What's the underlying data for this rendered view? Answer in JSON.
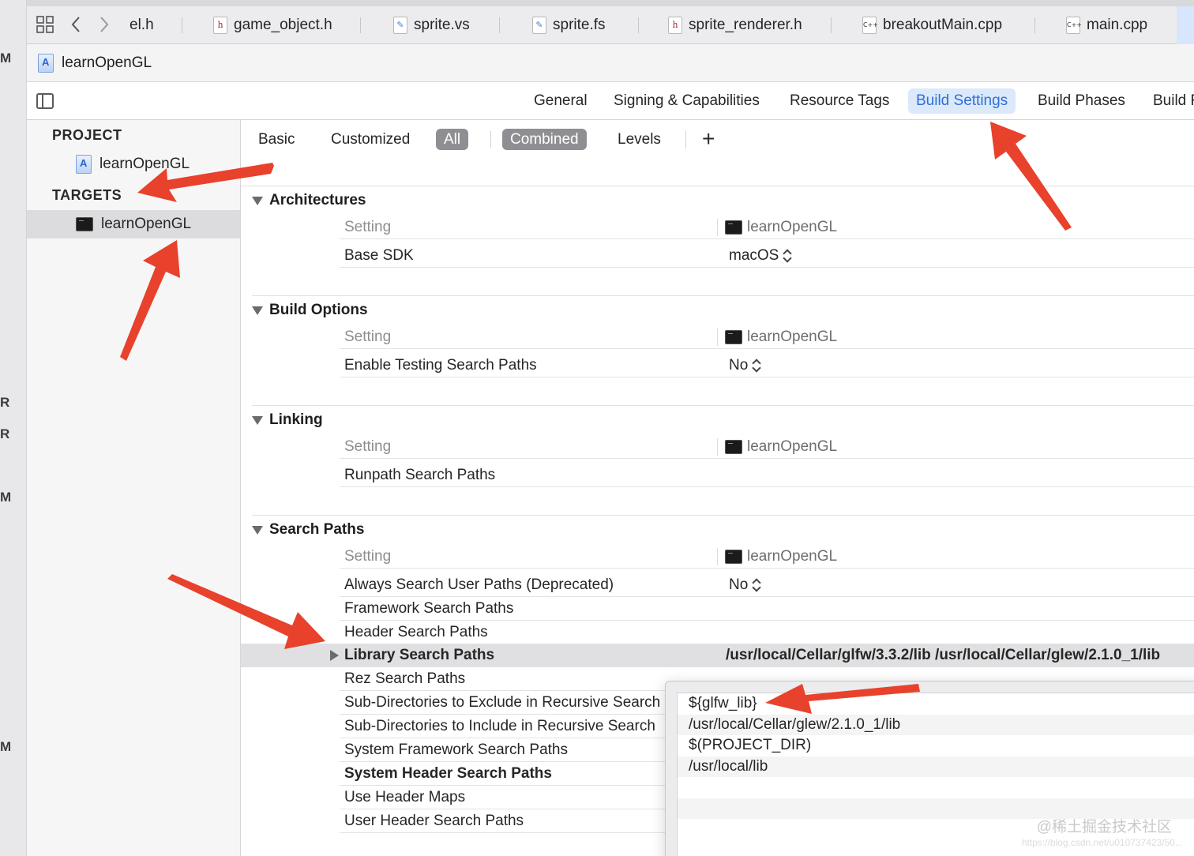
{
  "gutter": {
    "letters": [
      "M",
      "R",
      "R",
      "M",
      "M"
    ]
  },
  "tabbar": {
    "tabs": [
      {
        "label": "el.h",
        "icon": ""
      },
      {
        "label": "game_object.h",
        "icon": "h"
      },
      {
        "label": "sprite.vs",
        "icon": "✎"
      },
      {
        "label": "sprite.fs",
        "icon": "✎"
      },
      {
        "label": "sprite_renderer.h",
        "icon": "h"
      },
      {
        "label": "breakoutMain.cpp",
        "icon": "C++"
      },
      {
        "label": "main.cpp",
        "icon": "C++"
      }
    ]
  },
  "jumpbar": {
    "project": "learnOpenGL"
  },
  "editor_tabs": {
    "items": [
      "General",
      "Signing & Capabilities",
      "Resource Tags",
      "Build Settings",
      "Build Phases",
      "Build R"
    ],
    "active": "Build Settings"
  },
  "sidebar": {
    "project_header": "PROJECT",
    "project_item": "learnOpenGL",
    "targets_header": "TARGETS",
    "target_item": "learnOpenGL"
  },
  "filter": {
    "basic": "Basic",
    "customized": "Customized",
    "all": "All",
    "combined": "Combined",
    "levels": "Levels",
    "add": "+"
  },
  "sections": [
    {
      "title": "Architectures",
      "header_setting": "Setting",
      "header_target": "learnOpenGL",
      "rows": [
        {
          "name": "Base SDK",
          "value": "macOS",
          "stepper": true
        }
      ]
    },
    {
      "title": "Build Options",
      "header_setting": "Setting",
      "header_target": "learnOpenGL",
      "rows": [
        {
          "name": "Enable Testing Search Paths",
          "value": "No",
          "stepper": true
        }
      ]
    },
    {
      "title": "Linking",
      "header_setting": "Setting",
      "header_target": "learnOpenGL",
      "rows": [
        {
          "name": "Runpath Search Paths",
          "value": ""
        }
      ]
    },
    {
      "title": "Search Paths",
      "header_setting": "Setting",
      "header_target": "learnOpenGL",
      "rows": [
        {
          "name": "Always Search User Paths (Deprecated)",
          "value": "No",
          "stepper": true
        },
        {
          "name": "Framework Search Paths",
          "value": ""
        },
        {
          "name": "Header Search Paths",
          "value": ""
        },
        {
          "name": "Library Search Paths",
          "value": "/usr/local/Cellar/glfw/3.3.2/lib /usr/local/Cellar/glew/2.1.0_1/lib",
          "highlight": true
        },
        {
          "name": "Rez Search Paths",
          "value": ""
        },
        {
          "name": "Sub-Directories to Exclude in Recursive Search",
          "value": ""
        },
        {
          "name": "Sub-Directories to Include in Recursive Search",
          "value": ""
        },
        {
          "name": "System Framework Search Paths",
          "value": ""
        },
        {
          "name": "System Header Search Paths",
          "value": "",
          "bold": true
        },
        {
          "name": "Use Header Maps",
          "value": ""
        },
        {
          "name": "User Header Search Paths",
          "value": ""
        }
      ]
    }
  ],
  "popup": {
    "paths": [
      "${glfw_lib}",
      "/usr/local/Cellar/glew/2.1.0_1/lib",
      "$(PROJECT_DIR)",
      "/usr/local/lib",
      "",
      "",
      ""
    ]
  },
  "watermark": {
    "main": "@稀土掘金技术社区",
    "sub": "https://blog.csdn.net/u010737423/50..."
  },
  "colors": {
    "accent": "#2f6fd6",
    "annotation_arrow": "#e8412c",
    "selected_row": "#e0e0e2"
  }
}
